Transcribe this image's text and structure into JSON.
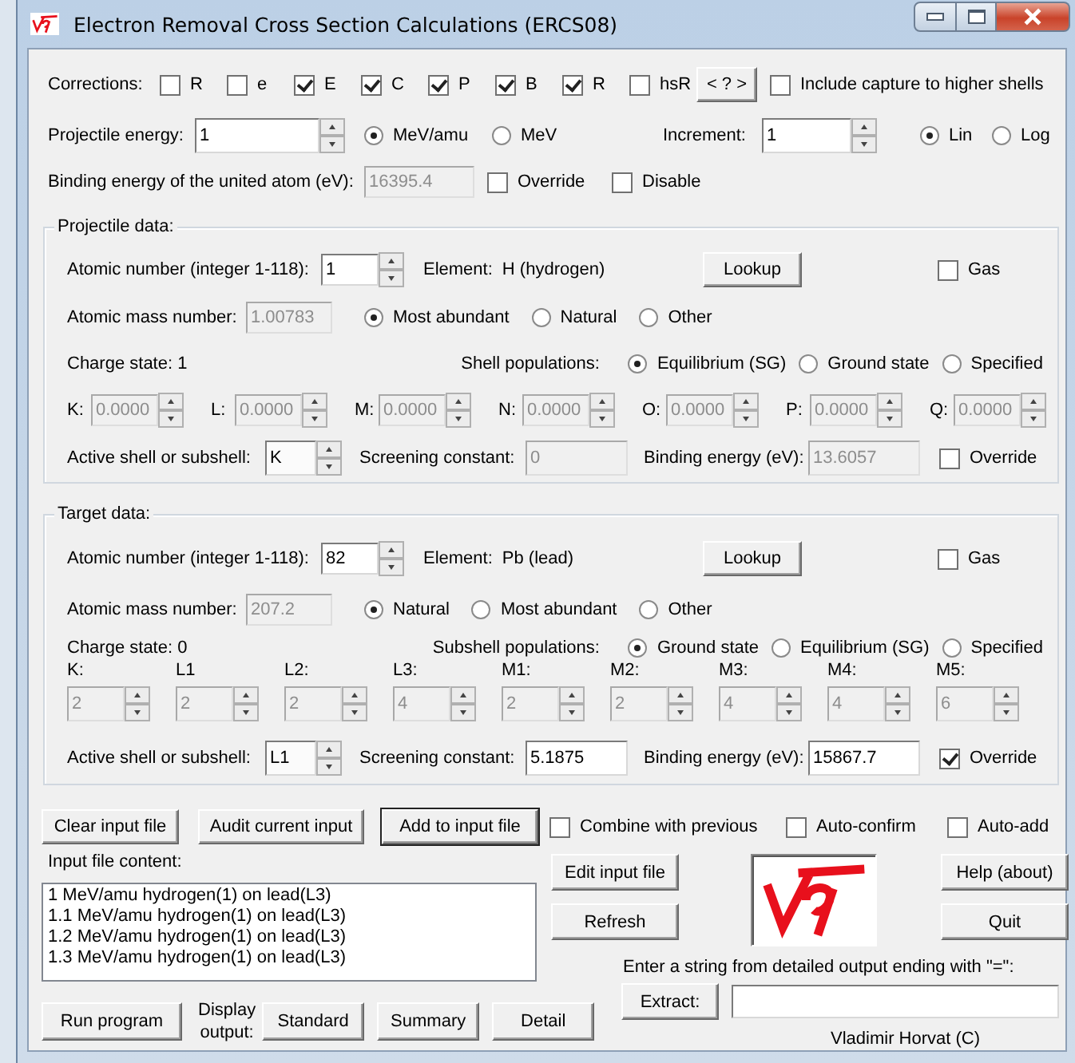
{
  "window": {
    "title": "Electron Removal Cross Section Calculations (ERCS08)"
  },
  "corrections": {
    "label": "Corrections:",
    "options": [
      {
        "label": "R",
        "checked": false
      },
      {
        "label": "e",
        "checked": false
      },
      {
        "label": "E",
        "checked": true
      },
      {
        "label": "C",
        "checked": true
      },
      {
        "label": "P",
        "checked": true
      },
      {
        "label": "B",
        "checked": true
      },
      {
        "label": "R",
        "checked": true
      },
      {
        "label": "hsR",
        "checked": false
      }
    ],
    "help_button": "< ? >",
    "capture": {
      "label": "Include capture to higher shells",
      "checked": false
    }
  },
  "energy": {
    "label": "Projectile energy:",
    "value": "1",
    "units": [
      {
        "label": "MeV/amu",
        "selected": true
      },
      {
        "label": "MeV",
        "selected": false
      }
    ],
    "increment_label": "Increment:",
    "increment": "1",
    "scales": [
      {
        "label": "Lin",
        "selected": true
      },
      {
        "label": "Log",
        "selected": false
      }
    ]
  },
  "united_atom": {
    "label": "Binding energy of the united atom (eV):",
    "value": "16395.4",
    "disabled": true,
    "options": [
      {
        "label": "Override",
        "checked": false
      },
      {
        "label": "Disable",
        "checked": false
      }
    ]
  },
  "groups": [
    {
      "legend": "Projectile data:",
      "atomic_number_label": "Atomic number (integer 1-118):",
      "atomic_number": "1",
      "element_label": "Element:",
      "element": "H (hydrogen)",
      "lookup_button": "Lookup",
      "gas": {
        "label": "Gas",
        "checked": false
      },
      "mass_label": "Atomic mass number:",
      "mass": "1.00783",
      "mass_disabled": true,
      "mass_options": [
        {
          "label": "Most abundant",
          "selected": true
        },
        {
          "label": "Natural",
          "selected": false
        },
        {
          "label": "Other",
          "selected": false
        }
      ],
      "charge_state": "Charge state: 1",
      "populations_label": "Shell populations:",
      "population_options": [
        {
          "label": "Equilibrium (SG)",
          "selected": true
        },
        {
          "label": "Ground state",
          "selected": false
        },
        {
          "label": "Specified",
          "selected": false
        }
      ],
      "kind": "inline",
      "shells": [
        {
          "label": "K:",
          "value": "0.0000",
          "disabled": true
        },
        {
          "label": "L:",
          "value": "0.0000",
          "disabled": true
        },
        {
          "label": "M:",
          "value": "0.0000",
          "disabled": true
        },
        {
          "label": "N:",
          "value": "0.0000",
          "disabled": true
        },
        {
          "label": "O:",
          "value": "0.0000",
          "disabled": true
        },
        {
          "label": "P:",
          "value": "0.0000",
          "disabled": true
        },
        {
          "label": "Q:",
          "value": "0.0000",
          "disabled": true
        }
      ],
      "active_label": "Active shell or subshell:",
      "active_shell": "K",
      "screening_label": "Screening constant:",
      "screening": "0",
      "screening_disabled": true,
      "binding_label": "Binding energy (eV):",
      "binding": "13.6057",
      "binding_disabled": true,
      "override": {
        "label": "Override",
        "checked": false
      }
    },
    {
      "legend": "Target data:",
      "atomic_number_label": "Atomic number (integer 1-118):",
      "atomic_number": "82",
      "element_label": "Element:",
      "element": "Pb (lead)",
      "lookup_button": "Lookup",
      "gas": {
        "label": "Gas",
        "checked": false
      },
      "mass_label": "Atomic mass number:",
      "mass": "207.2",
      "mass_disabled": true,
      "mass_options": [
        {
          "label": "Natural",
          "selected": true
        },
        {
          "label": "Most abundant",
          "selected": false
        },
        {
          "label": "Other",
          "selected": false
        }
      ],
      "charge_state": "Charge state: 0",
      "populations_label": "Subshell populations:",
      "population_options": [
        {
          "label": "Ground state",
          "selected": true
        },
        {
          "label": "Equilibrium (SG)",
          "selected": false
        },
        {
          "label": "Specified",
          "selected": false
        }
      ],
      "kind": "stacked",
      "shells": [
        {
          "label": "K:",
          "value": "2",
          "disabled": true
        },
        {
          "label": "L1",
          "value": "2",
          "disabled": true
        },
        {
          "label": "L2:",
          "value": "2",
          "disabled": true
        },
        {
          "label": "L3:",
          "value": "4",
          "disabled": true
        },
        {
          "label": "M1:",
          "value": "2",
          "disabled": true
        },
        {
          "label": "M2:",
          "value": "2",
          "disabled": true
        },
        {
          "label": "M3:",
          "value": "4",
          "disabled": true
        },
        {
          "label": "M4:",
          "value": "4",
          "disabled": true
        },
        {
          "label": "M5:",
          "value": "6",
          "disabled": true
        }
      ],
      "active_label": "Active shell or subshell:",
      "active_shell": "L1",
      "screening_label": "Screening constant:",
      "screening": "5.1875",
      "screening_disabled": false,
      "binding_label": "Binding energy (eV):",
      "binding": "15867.7",
      "binding_disabled": false,
      "override": {
        "label": "Override",
        "checked": true
      }
    }
  ],
  "file_buttons": [
    {
      "label": "Clear input file",
      "default": false
    },
    {
      "label": "Audit current input",
      "default": false
    },
    {
      "label": "Add to input file",
      "default": true
    }
  ],
  "file_options": [
    {
      "label": "Combine with previous",
      "checked": false
    },
    {
      "label": "Auto-confirm",
      "checked": false
    },
    {
      "label": "Auto-add",
      "checked": false
    }
  ],
  "content_label": "Input file content:",
  "content_lines": [
    "1 MeV/amu hydrogen(1) on lead(L3)",
    "1.1 MeV/amu hydrogen(1) on lead(L3)",
    "1.2 MeV/amu hydrogen(1) on lead(L3)",
    "1.3 MeV/amu hydrogen(1) on lead(L3)"
  ],
  "edit_button": "Edit input file",
  "refresh_button": "Refresh",
  "help_button": "Help (about)",
  "quit_button": "Quit",
  "extract_prompt": "Enter a string from detailed output ending with \"=\":",
  "extract_button": "Extract:",
  "run_button": "Run program",
  "display_label": "Display output:",
  "display_buttons": [
    "Standard",
    "Summary",
    "Detail"
  ],
  "author": "Vladimir Horvat (C)"
}
